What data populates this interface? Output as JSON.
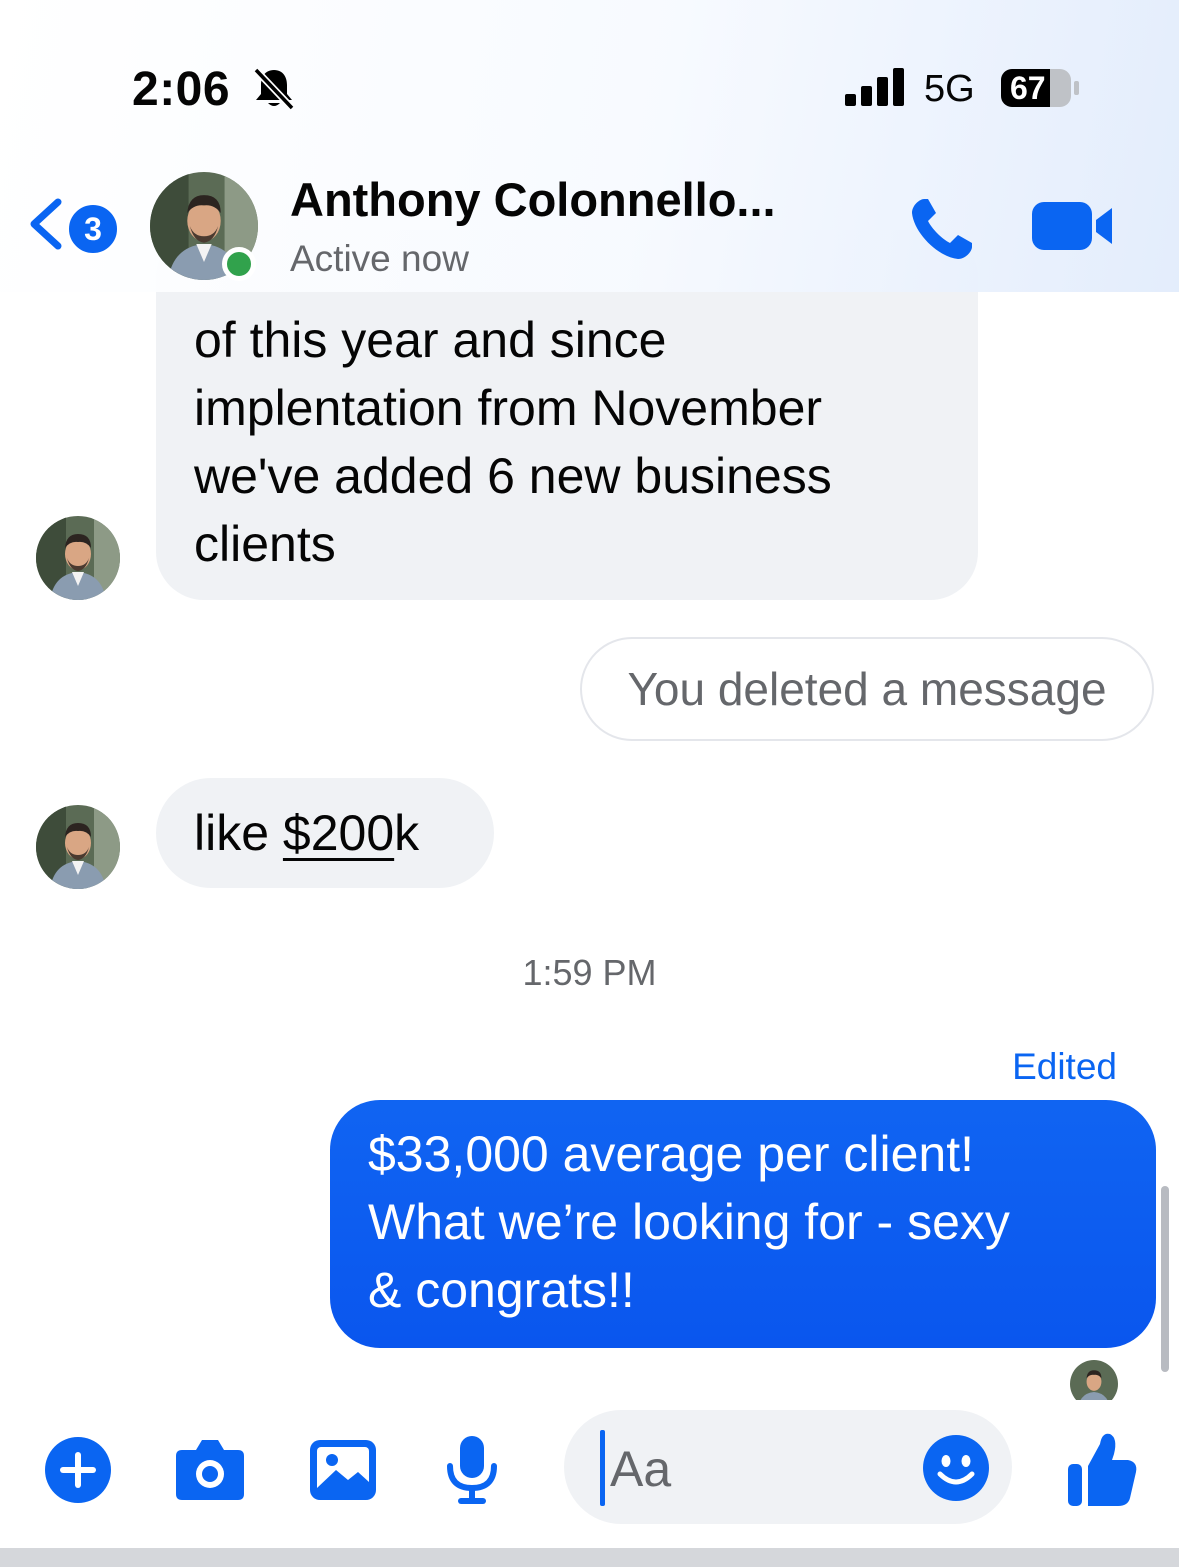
{
  "status_bar": {
    "time": "2:06",
    "network": "5G",
    "battery": "67"
  },
  "header": {
    "back_badge": "3",
    "contact_name": "Anthony Colonnello...",
    "contact_status": "Active now"
  },
  "messages": {
    "incoming_long": {
      "lines": [
        "of this year and since",
        "implentation from November",
        "we've added 6 new business",
        "clients"
      ]
    },
    "deleted_notice": "You deleted a message",
    "incoming_short": {
      "prefix": "like ",
      "link": "$200",
      "suffix": "k"
    },
    "timestamp": "1:59 PM",
    "edited_label": "Edited",
    "outgoing": {
      "lines": [
        "$33,000 average per client!",
        "What we’re looking for - sexy",
        "& congrats!!"
      ]
    }
  },
  "composer": {
    "placeholder": "Aa"
  },
  "colors": {
    "accent": "#0a65f2",
    "bubble_in": "#f0f2f5",
    "online": "#31a24c",
    "secondary_text": "#65676b"
  },
  "icons": [
    "bell-off-icon",
    "signal-icon",
    "battery-icon",
    "back-chevron-icon",
    "phone-icon",
    "video-camera-icon",
    "plus-icon",
    "camera-icon",
    "gallery-icon",
    "microphone-icon",
    "emoji-icon",
    "thumbs-up-icon"
  ]
}
